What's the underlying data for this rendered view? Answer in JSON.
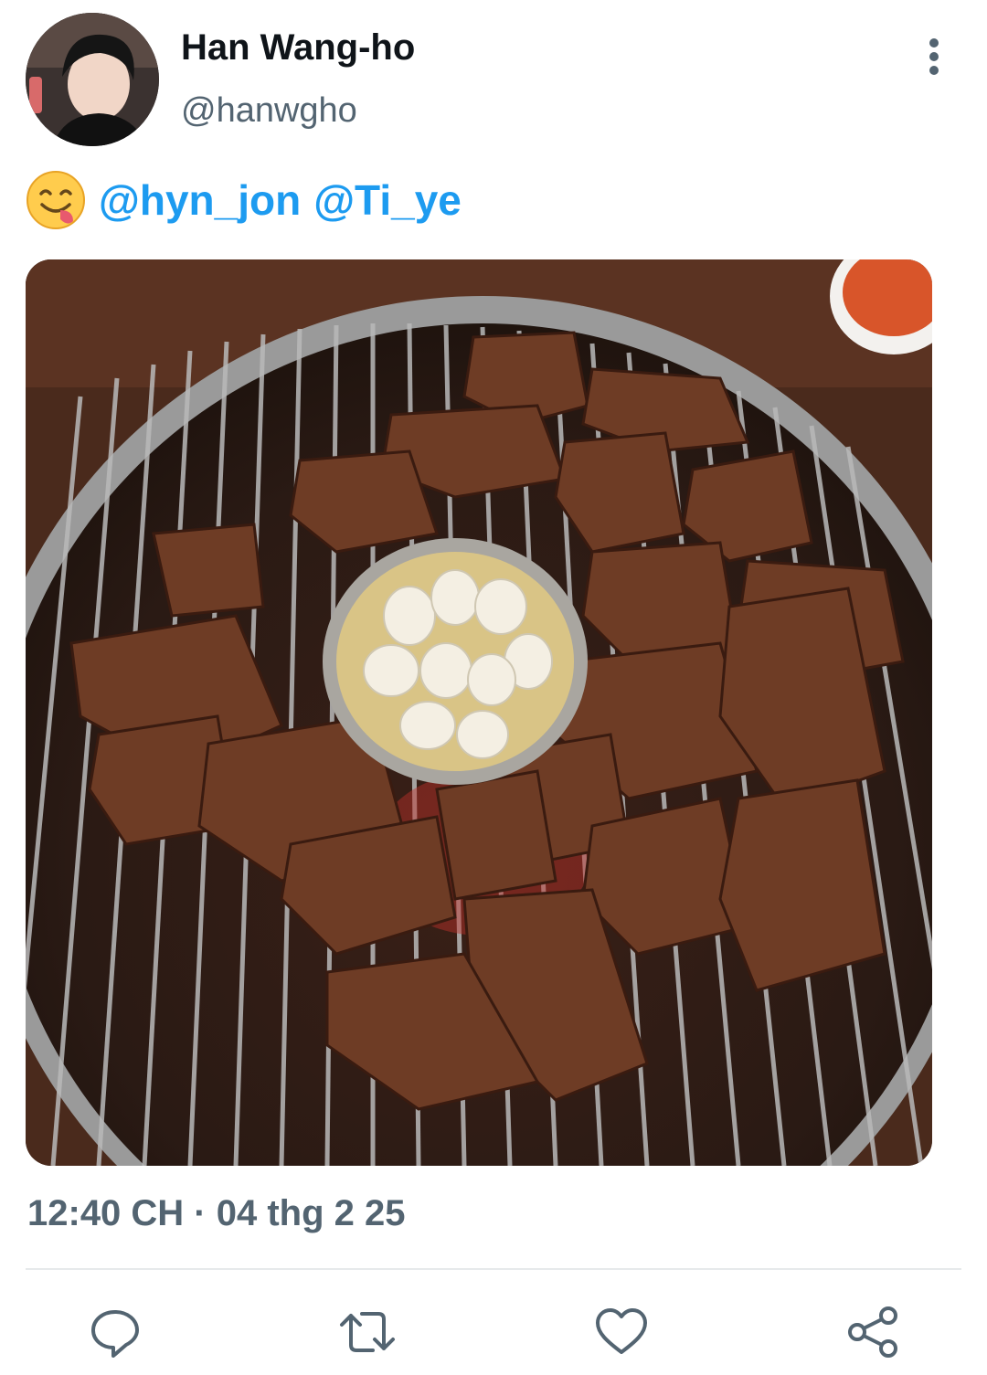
{
  "author": {
    "display_name": "Han Wang-ho",
    "handle": "@hanwgho"
  },
  "tweet": {
    "emoji": "yum-face-emoji",
    "mentions": [
      "@hyn_jon",
      "@Ti_ye"
    ],
    "media": "photo of grilled pork on a barbecue grill with garlic in oil",
    "timestamp": "12:40 CH · 04 thg 2 25"
  },
  "actions": {
    "icons": [
      "reply-icon",
      "retweet-icon",
      "like-icon",
      "share-icon"
    ]
  },
  "colors": {
    "link": "#1d9bf0",
    "secondary_text": "#536471",
    "icon": "#536471",
    "divider": "#e6e9eb"
  }
}
